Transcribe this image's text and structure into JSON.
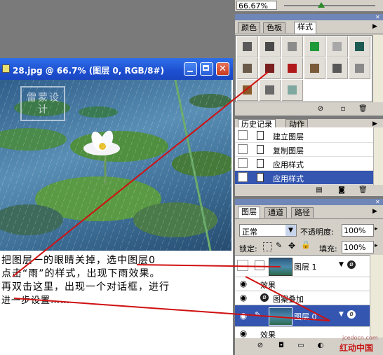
{
  "zoom_field": {
    "value": "66.67%"
  },
  "document": {
    "title": "28.jpg @ 66.7% (图层 0, RGB/8#)",
    "watermark": "雷蒙设计"
  },
  "annotation": {
    "lines": [
      "把图层一的眼睛关掉，选中图层0",
      "点击“雨”的样式，出现下雨效果。",
      "再双击这里，出现一个对话框，进行",
      "进一步设置……"
    ]
  },
  "styles_panel": {
    "tabs": [
      "颜色",
      "色板",
      "样式"
    ],
    "active_tab": "样式",
    "swatches": [
      {
        "name": "style-default",
        "color": "#5a5a5a"
      },
      {
        "name": "style-dark",
        "color": "#4a4a4a"
      },
      {
        "name": "style-gray",
        "color": "#8c8c8c"
      },
      {
        "name": "style-green",
        "color": "#1f9a3a"
      },
      {
        "name": "style-light-gray",
        "color": "#a8a8a8"
      },
      {
        "name": "style-teal",
        "color": "#1d5a52"
      },
      {
        "name": "style-mosaic",
        "color": "#6a5a4a"
      },
      {
        "name": "style-rain",
        "color": "#7a2020"
      },
      {
        "name": "style-red",
        "color": "#b01a1a"
      },
      {
        "name": "style-brown",
        "color": "#7a5a3a"
      },
      {
        "name": "style-checker",
        "color": "#585858"
      },
      {
        "name": "style-noise",
        "color": "#8a8a8a"
      },
      {
        "name": "style-wood",
        "color": "#8a5a2a"
      },
      {
        "name": "style-bevel",
        "color": "#6a6a6a"
      },
      {
        "name": "style-glass",
        "color": "#7fa8a0"
      }
    ]
  },
  "history_panel": {
    "tabs": [
      "历史记录",
      "动作"
    ],
    "active_tab": "历史记录",
    "items": [
      {
        "label": "建立图层",
        "selected": false
      },
      {
        "label": "复制图层",
        "selected": false
      },
      {
        "label": "应用样式",
        "selected": false
      },
      {
        "label": "应用样式",
        "selected": true
      }
    ]
  },
  "layers_panel": {
    "tabs": [
      "图层",
      "通道",
      "路径"
    ],
    "active_tab": "图层",
    "blend_mode": "正常",
    "opacity_label": "不透明度:",
    "opacity_value": "100%",
    "lock_label": "锁定:",
    "fill_label": "填充:",
    "fill_value": "100%",
    "layers": [
      {
        "name": "图层 1",
        "visible": false,
        "selected": false,
        "effects_label": "效果",
        "effects": [
          "图案叠加"
        ]
      },
      {
        "name": "图层 0",
        "visible": true,
        "selected": true,
        "effects_label": "效果",
        "effects": []
      }
    ]
  },
  "watermark_site": {
    "url": "jcedocn.com",
    "brand": "红动中国"
  }
}
